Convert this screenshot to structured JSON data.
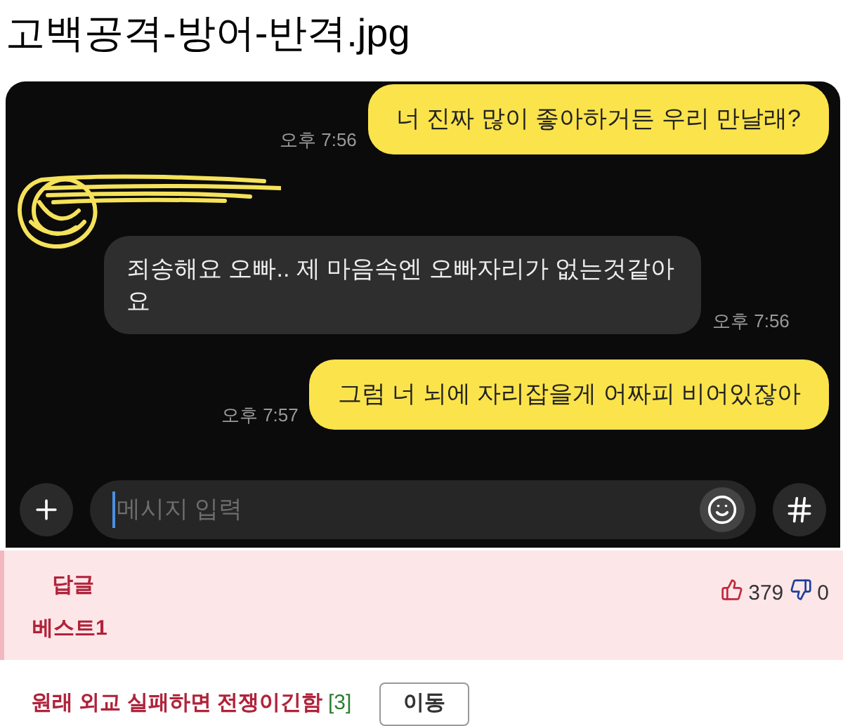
{
  "title": "고백공격-방어-반격.jpg",
  "messages": [
    {
      "kind": "sent",
      "text": "너 진짜 많이 좋아하거든 우리 만날래?",
      "time": "오후 7:56"
    },
    {
      "kind": "received",
      "text": "죄송해요 오빠.. 제 마음속엔 오빠자리가 없는것같아요",
      "time": "오후 7:56"
    },
    {
      "kind": "sent",
      "text": "그럼 너 뇌에 자리잡을게 어짜피 비어있잖아",
      "time": "오후 7:57"
    }
  ],
  "composer": {
    "placeholder": "메시지 입력"
  },
  "reply": {
    "label": "답글",
    "rank": "베스트1",
    "likes": "379",
    "dislikes": "0"
  },
  "post": {
    "title": "원래 외교 실패하면 전쟁이긴함",
    "comment_count": "[3]",
    "button": "이동"
  }
}
